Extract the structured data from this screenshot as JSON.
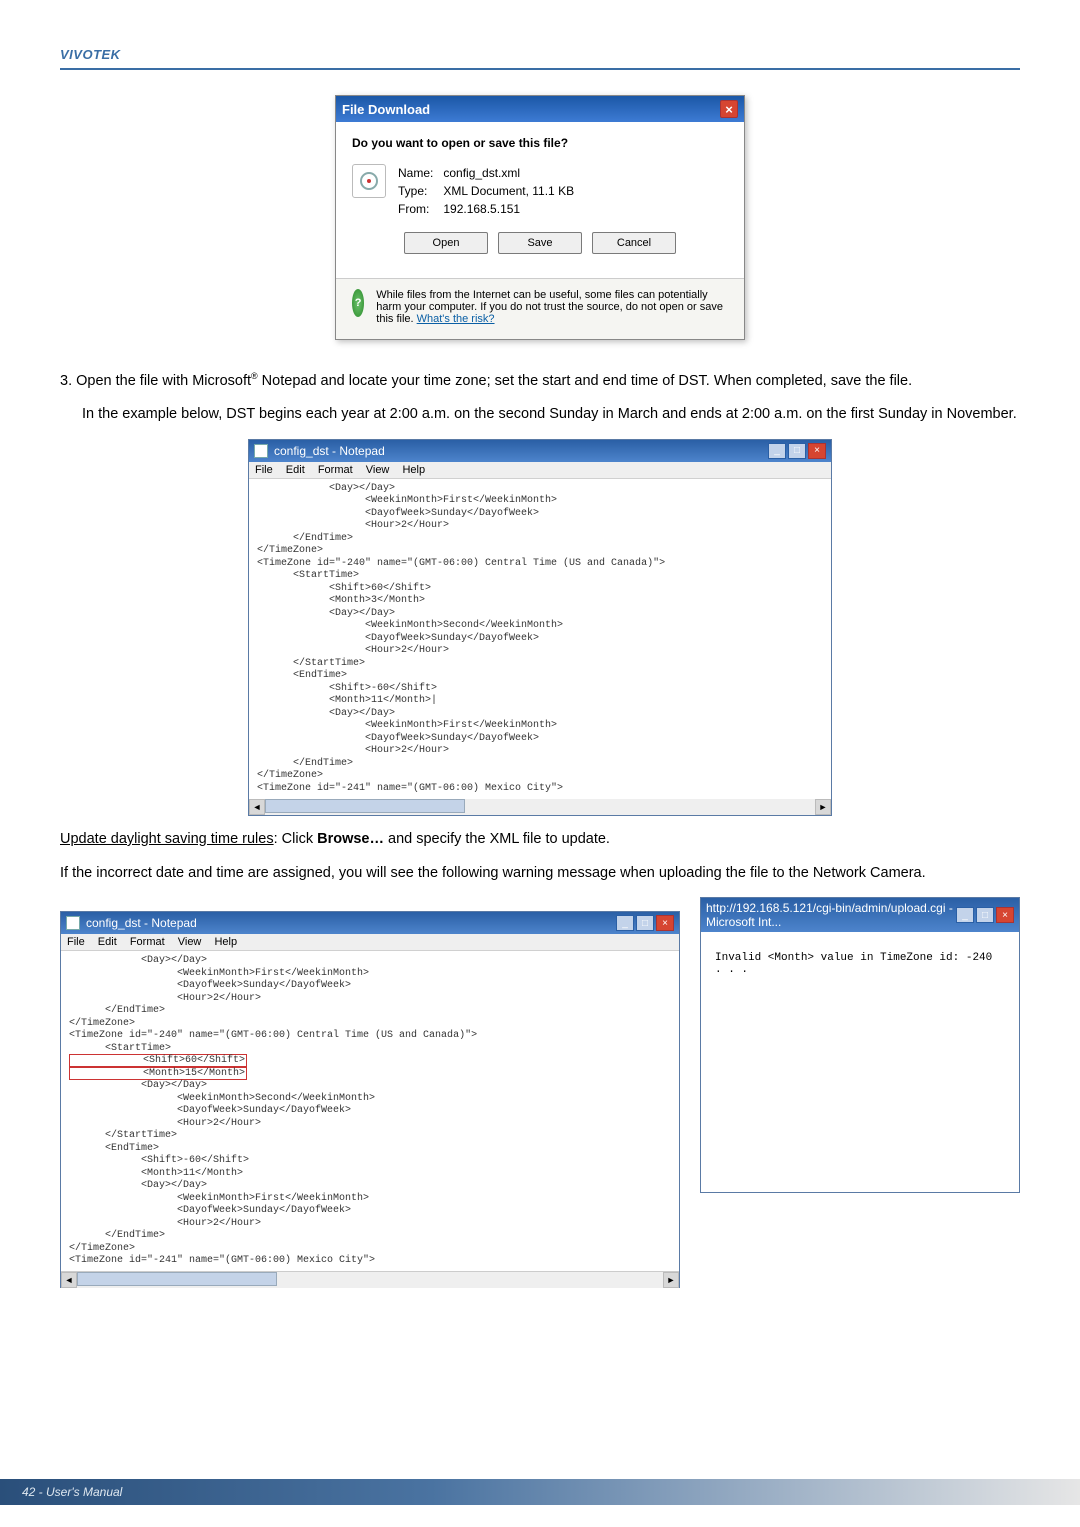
{
  "header": {
    "brand": "VIVOTEK"
  },
  "file_download": {
    "title": "File Download",
    "question": "Do you want to open or save this file?",
    "name_label": "Name:",
    "name_value": "config_dst.xml",
    "type_label": "Type:",
    "type_value": "XML Document, 11.1 KB",
    "from_label": "From:",
    "from_value": "192.168.5.151",
    "btn_open": "Open",
    "btn_save": "Save",
    "btn_cancel": "Cancel",
    "warn": "While files from the Internet can be useful, some files can potentially harm your computer. If you do not trust the source, do not open or save this file. ",
    "warn_link": "What's the risk?"
  },
  "step3": {
    "num": "3.",
    "text_a": "Open the file with Microsoft",
    "reg": "®",
    "text_b": " Notepad and locate your time zone; set the start and end time of DST. When completed, save the file.",
    "example": "In the example below, DST begins each year at 2:00 a.m. on the second Sunday in March and ends at 2:00 a.m. on the first Sunday in November."
  },
  "notepad1": {
    "title": "config_dst - Notepad",
    "menu": {
      "file": "File",
      "edit": "Edit",
      "format": "Format",
      "view": "View",
      "help": "Help"
    },
    "content": "            <Day></Day>\n                  <WeekinMonth>First</WeekinMonth>\n                  <DayofWeek>Sunday</DayofWeek>\n                  <Hour>2</Hour>\n      </EndTime>\n</TimeZone>\n<TimeZone id=\"-240\" name=\"(GMT-06:00) Central Time (US and Canada)\">\n      <StartTime>\n            <Shift>60</Shift>\n            <Month>3</Month>\n            <Day></Day>\n                  <WeekinMonth>Second</WeekinMonth>\n                  <DayofWeek>Sunday</DayofWeek>\n                  <Hour>2</Hour>\n      </StartTime>\n      <EndTime>\n            <Shift>-60</Shift>\n            <Month>11</Month>|\n            <Day></Day>\n                  <WeekinMonth>First</WeekinMonth>\n                  <DayofWeek>Sunday</DayofWeek>\n                  <Hour>2</Hour>\n      </EndTime>\n</TimeZone>\n<TimeZone id=\"-241\" name=\"(GMT-06:00) Mexico City\">"
  },
  "update_para": {
    "lead": "Update daylight saving time rules",
    "rest": ": Click ",
    "bold": "Browse…",
    "tail": " and specify the XML file to update."
  },
  "warn_para": "If the incorrect date and time are assigned, you will see the following warning message when uploading the file to the Network Camera.",
  "notepad2": {
    "title": "config_dst - Notepad",
    "menu": {
      "file": "File",
      "edit": "Edit",
      "format": "Format",
      "view": "View",
      "help": "Help"
    },
    "content_pre": "            <Day></Day>\n                  <WeekinMonth>First</WeekinMonth>\n                  <DayofWeek>Sunday</DayofWeek>\n                  <Hour>2</Hour>\n      </EndTime>\n</TimeZone>\n<TimeZone id=\"-240\" name=\"(GMT-06:00) Central Time (US and Canada)\">\n      <StartTime>\n",
    "shift_line": "            <Shift>60</Shift>",
    "month_line": "            <Month>15</Month>",
    "content_post": "\n            <Day></Day>\n                  <WeekinMonth>Second</WeekinMonth>\n                  <DayofWeek>Sunday</DayofWeek>\n                  <Hour>2</Hour>\n      </StartTime>\n      <EndTime>\n            <Shift>-60</Shift>\n            <Month>11</Month>\n            <Day></Day>\n                  <WeekinMonth>First</WeekinMonth>\n                  <DayofWeek>Sunday</DayofWeek>\n                  <Hour>2</Hour>\n      </EndTime>\n</TimeZone>\n<TimeZone id=\"-241\" name=\"(GMT-06:00) Mexico City\">"
  },
  "ie": {
    "title": "http://192.168.5.121/cgi-bin/admin/upload.cgi - Microsoft Int...",
    "error": "Invalid <Month> value in TimeZone id: -240 . . ."
  },
  "footer": {
    "text": "42 - User's Manual"
  }
}
